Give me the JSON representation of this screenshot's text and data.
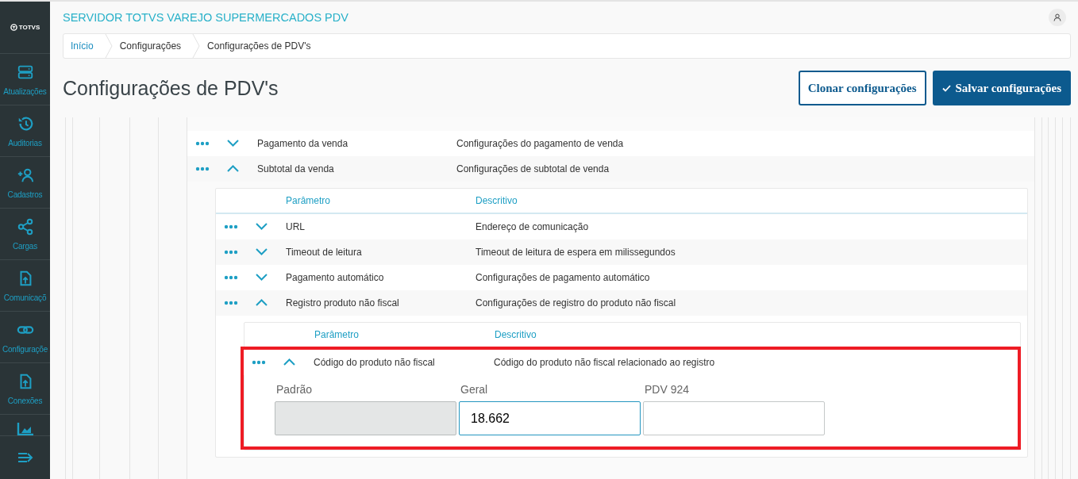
{
  "sidebar": {
    "logo": "TOTVS",
    "items": [
      {
        "label": "Atualizações"
      },
      {
        "label": "Auditorias"
      },
      {
        "label": "Cadastros"
      },
      {
        "label": "Cargas"
      },
      {
        "label": "Comunicaçõ"
      },
      {
        "label": "Configuraçõe"
      },
      {
        "label": "Conexões"
      }
    ]
  },
  "header": {
    "title": "SERVIDOR TOTVS VAREJO SUPERMERCADOS PDV"
  },
  "breadcrumbs": [
    {
      "label": "Início",
      "kind": "link"
    },
    {
      "label": "Configurações",
      "kind": "text"
    },
    {
      "label": "Configurações de PDV's",
      "kind": "text"
    }
  ],
  "page_title": "Configurações de PDV's",
  "buttons": [
    {
      "label": "Clonar configurações",
      "kind": "outline"
    },
    {
      "label": "Salvar configurações",
      "kind": "primary"
    }
  ],
  "config": {
    "rows": [
      {
        "name": "Pagamento da venda",
        "description": "Configurações do pagamento de venda",
        "expanded": false
      },
      {
        "name": "Subtotal da venda",
        "description": "Configurações de subtotal de venda",
        "expanded": true,
        "children": {
          "columns": [
            "Parâmetro",
            "Descritivo"
          ],
          "rows": [
            {
              "name": "URL",
              "description": "Endereço de comunicação",
              "expanded": false
            },
            {
              "name": "Timeout de leitura",
              "description": "Timeout de leitura de espera em milissegundos",
              "expanded": false
            },
            {
              "name": "Pagamento automático",
              "description": "Configurações de pagamento automático",
              "expanded": false
            },
            {
              "name": "Registro produto não fiscal",
              "description": "Configurações de registro do produto não fiscal",
              "expanded": true,
              "children": {
                "columns": [
                  "Parâmetro",
                  "Descritivo"
                ],
                "rows": [
                  {
                    "name": "Código do produto não fiscal",
                    "description": "Código do produto não fiscal relacionado ao registro",
                    "expanded": true,
                    "highlighted": true,
                    "values": [
                      {
                        "label": "Padrão",
                        "disabled": true,
                        "focused": false
                      },
                      {
                        "label": "Geral",
                        "value": "18.662",
                        "disabled": false,
                        "focused": true
                      },
                      {
                        "label": "PDV 924",
                        "disabled": false,
                        "focused": false
                      }
                    ]
                  }
                ]
              }
            }
          ]
        }
      }
    ]
  }
}
